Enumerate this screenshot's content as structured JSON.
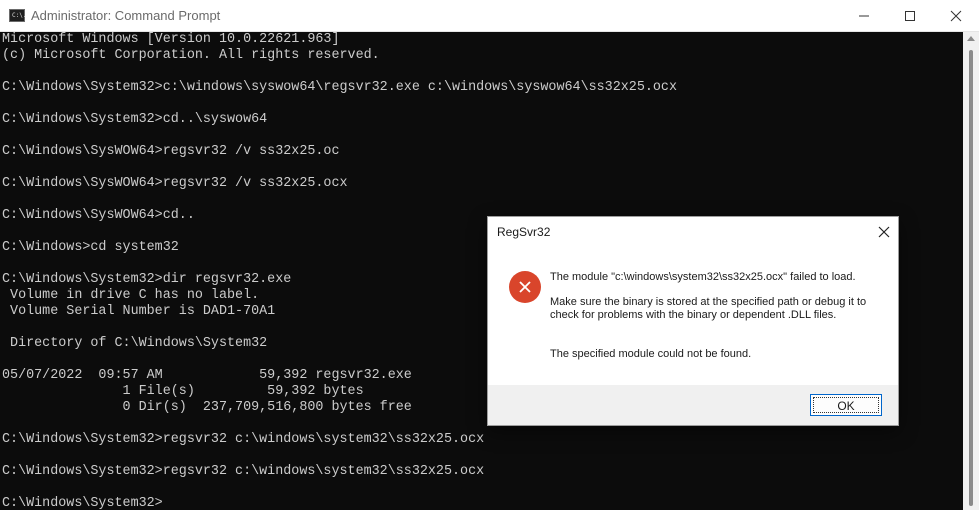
{
  "window": {
    "title": "Administrator: Command Prompt",
    "icon_text": "C:\\.",
    "controls": [
      "minimize-icon",
      "maximize-icon",
      "close-icon"
    ]
  },
  "console": {
    "lines": [
      "Microsoft Windows [Version 10.0.22621.963]",
      "(c) Microsoft Corporation. All rights reserved.",
      "",
      "C:\\Windows\\System32>c:\\windows\\syswow64\\regsvr32.exe c:\\windows\\syswow64\\ss32x25.ocx",
      "",
      "C:\\Windows\\System32>cd..\\syswow64",
      "",
      "C:\\Windows\\SysWOW64>regsvr32 /v ss32x25.oc",
      "",
      "C:\\Windows\\SysWOW64>regsvr32 /v ss32x25.ocx",
      "",
      "C:\\Windows\\SysWOW64>cd..",
      "",
      "C:\\Windows>cd system32",
      "",
      "C:\\Windows\\System32>dir regsvr32.exe",
      " Volume in drive C has no label.",
      " Volume Serial Number is DAD1-70A1",
      "",
      " Directory of C:\\Windows\\System32",
      "",
      "05/07/2022  09:57 AM            59,392 regsvr32.exe",
      "               1 File(s)         59,392 bytes",
      "               0 Dir(s)  237,709,516,800 bytes free",
      "",
      "C:\\Windows\\System32>regsvr32 c:\\windows\\system32\\ss32x25.ocx",
      "",
      "C:\\Windows\\System32>regsvr32 c:\\windows\\system32\\ss32x25.ocx",
      "",
      "C:\\Windows\\System32>"
    ]
  },
  "dialog": {
    "title": "RegSvr32",
    "icon": "error-icon",
    "messages": [
      "The module \"c:\\windows\\system32\\ss32x25.ocx\" failed to load.",
      "Make sure the binary is stored at the specified path or debug it to check for problems with the binary or dependent .DLL files.",
      "The specified module could not be found."
    ],
    "ok_label": "OK",
    "accent": "#0066cc",
    "error_color": "#d9452b"
  }
}
